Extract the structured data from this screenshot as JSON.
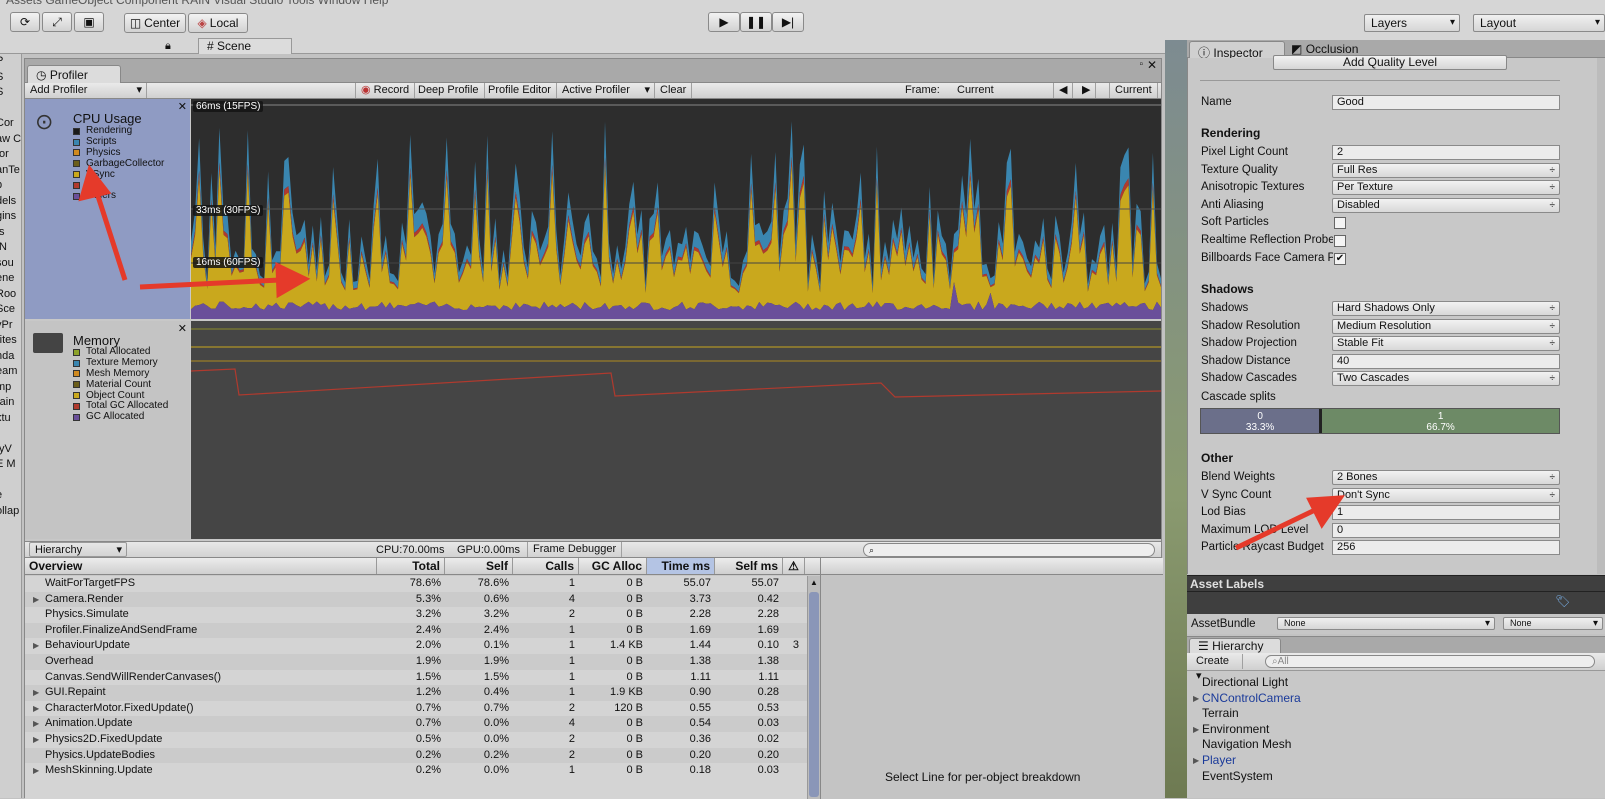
{
  "menu": {
    "items": [
      "Assets",
      "GameObject",
      "Component",
      "RAIN",
      "Visual Studio Tools",
      "Window",
      "Help"
    ]
  },
  "toolbar": {
    "pivot_label": "Center",
    "space_label": "Local",
    "layers_label": "Layers",
    "layout_label": "Layout"
  },
  "scene_tab": {
    "label": "Scene"
  },
  "left_strip": {
    "items": [
      "P",
      "S",
      "S",
      "",
      "Cor",
      "aw C",
      "tor",
      "anTe",
      "p",
      "dels",
      "gins",
      "fs",
      "IN",
      "sou",
      "ene",
      "Roo",
      "Sce",
      "yPr",
      "rites",
      "nda",
      "eam",
      "mp",
      "rain",
      "xtu",
      "",
      "tyV",
      "E M",
      "",
      "e",
      "ollap"
    ]
  },
  "profiler": {
    "tab_label": "Profiler",
    "add_profiler": "Add Profiler",
    "toolbar": {
      "record": "Record",
      "deep_profile": "Deep Profile",
      "profile_editor": "Profile Editor",
      "active_profiler": "Active Profiler",
      "clear": "Clear",
      "frame_label": "Frame:",
      "frame_value": "Current",
      "current_btn": "Current"
    },
    "cpu": {
      "title": "CPU Usage",
      "legend": [
        {
          "label": "Rendering",
          "color": "#1a1a1a"
        },
        {
          "label": "Scripts",
          "color": "#3a86b0"
        },
        {
          "label": "Physics",
          "color": "#d08a20"
        },
        {
          "label": "GarbageCollector",
          "color": "#6a5d1a"
        },
        {
          "label": "VSync",
          "color": "#c9a81d"
        },
        {
          "label": "GI",
          "color": "#b03a2e"
        },
        {
          "label": "Others",
          "color": "#6a4f9a"
        }
      ],
      "markers": [
        "66ms (15FPS)",
        "33ms (30FPS)",
        "16ms (60FPS)"
      ]
    },
    "memory": {
      "title": "Memory",
      "legend": [
        {
          "label": "Total Allocated",
          "color": "#8da32a"
        },
        {
          "label": "Texture Memory",
          "color": "#3a86b0"
        },
        {
          "label": "Mesh Memory",
          "color": "#d08a20"
        },
        {
          "label": "Material Count",
          "color": "#6a5d1a"
        },
        {
          "label": "Object Count",
          "color": "#c9a81d"
        },
        {
          "label": "Total GC Allocated",
          "color": "#b03a2e"
        },
        {
          "label": "GC Allocated",
          "color": "#6a4f9a"
        }
      ]
    },
    "hierarchy_bar": {
      "mode": "Hierarchy",
      "cpu": "CPU:70.00ms",
      "gpu": "GPU:0.00ms",
      "frame_debugger": "Frame Debugger"
    },
    "columns": [
      "Overview",
      "Total",
      "Self",
      "Calls",
      "GC Alloc",
      "Time ms",
      "Self ms"
    ],
    "rows": [
      {
        "name": "WaitForTargetFPS",
        "expand": false,
        "total": "78.6%",
        "self": "78.6%",
        "calls": "1",
        "gc": "0 B",
        "time": "55.07",
        "selfms": "55.07",
        "warn": ""
      },
      {
        "name": "Camera.Render",
        "expand": true,
        "total": "5.3%",
        "self": "0.6%",
        "calls": "4",
        "gc": "0 B",
        "time": "3.73",
        "selfms": "0.42",
        "warn": ""
      },
      {
        "name": "Physics.Simulate",
        "expand": false,
        "total": "3.2%",
        "self": "3.2%",
        "calls": "2",
        "gc": "0 B",
        "time": "2.28",
        "selfms": "2.28",
        "warn": ""
      },
      {
        "name": "Profiler.FinalizeAndSendFrame",
        "expand": false,
        "total": "2.4%",
        "self": "2.4%",
        "calls": "1",
        "gc": "0 B",
        "time": "1.69",
        "selfms": "1.69",
        "warn": ""
      },
      {
        "name": "BehaviourUpdate",
        "expand": true,
        "total": "2.0%",
        "self": "0.1%",
        "calls": "1",
        "gc": "1.4 KB",
        "time": "1.44",
        "selfms": "0.10",
        "warn": "3"
      },
      {
        "name": "Overhead",
        "expand": false,
        "total": "1.9%",
        "self": "1.9%",
        "calls": "1",
        "gc": "0 B",
        "time": "1.38",
        "selfms": "1.38",
        "warn": ""
      },
      {
        "name": "Canvas.SendWillRenderCanvases()",
        "expand": false,
        "total": "1.5%",
        "self": "1.5%",
        "calls": "1",
        "gc": "0 B",
        "time": "1.11",
        "selfms": "1.11",
        "warn": ""
      },
      {
        "name": "GUI.Repaint",
        "expand": true,
        "total": "1.2%",
        "self": "0.4%",
        "calls": "1",
        "gc": "1.9 KB",
        "time": "0.90",
        "selfms": "0.28",
        "warn": ""
      },
      {
        "name": "CharacterMotor.FixedUpdate()",
        "expand": true,
        "total": "0.7%",
        "self": "0.7%",
        "calls": "2",
        "gc": "120 B",
        "time": "0.55",
        "selfms": "0.53",
        "warn": ""
      },
      {
        "name": "Animation.Update",
        "expand": true,
        "total": "0.7%",
        "self": "0.0%",
        "calls": "4",
        "gc": "0 B",
        "time": "0.54",
        "selfms": "0.03",
        "warn": ""
      },
      {
        "name": "Physics2D.FixedUpdate",
        "expand": true,
        "total": "0.5%",
        "self": "0.0%",
        "calls": "2",
        "gc": "0 B",
        "time": "0.36",
        "selfms": "0.02",
        "warn": ""
      },
      {
        "name": "Physics.UpdateBodies",
        "expand": false,
        "total": "0.2%",
        "self": "0.2%",
        "calls": "2",
        "gc": "0 B",
        "time": "0.20",
        "selfms": "0.20",
        "warn": ""
      },
      {
        "name": "MeshSkinning.Update",
        "expand": true,
        "total": "0.2%",
        "self": "0.0%",
        "calls": "1",
        "gc": "0 B",
        "time": "0.18",
        "selfms": "0.03",
        "warn": ""
      }
    ],
    "right_pane_text": "Select Line for per-object breakdown"
  },
  "inspector": {
    "tab_label": "Inspector",
    "occlusion_label": "Occlusion",
    "add_quality": "Add Quality Level",
    "name_label": "Name",
    "name_value": "Good",
    "sections": {
      "rendering": "Rendering",
      "shadows": "Shadows",
      "other": "Other"
    },
    "rendering": [
      {
        "label": "Pixel Light Count",
        "value": "2",
        "kind": "field"
      },
      {
        "label": "Texture Quality",
        "value": "Full Res",
        "kind": "dropdown"
      },
      {
        "label": "Anisotropic Textures",
        "value": "Per Texture",
        "kind": "dropdown"
      },
      {
        "label": "Anti Aliasing",
        "value": "Disabled",
        "kind": "dropdown"
      },
      {
        "label": "Soft Particles",
        "value": "",
        "kind": "checkbox"
      },
      {
        "label": "Realtime Reflection Probes",
        "value": "",
        "kind": "checkbox"
      },
      {
        "label": "Billboards Face Camera Position",
        "value": "✔",
        "kind": "checkbox"
      }
    ],
    "shadows": [
      {
        "label": "Shadows",
        "value": "Hard Shadows Only",
        "kind": "dropdown"
      },
      {
        "label": "Shadow Resolution",
        "value": "Medium Resolution",
        "kind": "dropdown"
      },
      {
        "label": "Shadow Projection",
        "value": "Stable Fit",
        "kind": "dropdown"
      },
      {
        "label": "Shadow Distance",
        "value": "40",
        "kind": "field"
      },
      {
        "label": "Shadow Cascades",
        "value": "Two Cascades",
        "kind": "dropdown"
      }
    ],
    "cascade_splits_label": "Cascade splits",
    "cascade": [
      {
        "index": "0",
        "percent": "33.3%",
        "fraction": 0.333,
        "color": "#6b6f8a"
      },
      {
        "index": "1",
        "percent": "66.7%",
        "fraction": 0.667,
        "color": "#6d8a66"
      }
    ],
    "other": [
      {
        "label": "Blend Weights",
        "value": "2 Bones",
        "kind": "dropdown"
      },
      {
        "label": "V Sync Count",
        "value": "Don't Sync",
        "kind": "dropdown"
      },
      {
        "label": "Lod Bias",
        "value": "1",
        "kind": "field"
      },
      {
        "label": "Maximum LOD Level",
        "value": "0",
        "kind": "field"
      },
      {
        "label": "Particle Raycast Budget",
        "value": "256",
        "kind": "field"
      }
    ]
  },
  "asset_labels": {
    "title": "Asset Labels",
    "bundle_label": "AssetBundle",
    "bundle_value": "None",
    "variant_value": "None"
  },
  "hierarchy": {
    "tab_label": "Hierarchy",
    "create_label": "Create",
    "search_placeholder": "All",
    "items": [
      {
        "label": "Directional Light",
        "expand": false,
        "prefab": false
      },
      {
        "label": "CNControlCamera",
        "expand": true,
        "prefab": true
      },
      {
        "label": "Terrain",
        "expand": false,
        "prefab": false
      },
      {
        "label": "Environment",
        "expand": true,
        "prefab": false
      },
      {
        "label": "Navigation Mesh",
        "expand": false,
        "prefab": false
      },
      {
        "label": "Player",
        "expand": true,
        "prefab": true
      },
      {
        "label": "EventSystem",
        "expand": false,
        "prefab": false
      }
    ]
  }
}
